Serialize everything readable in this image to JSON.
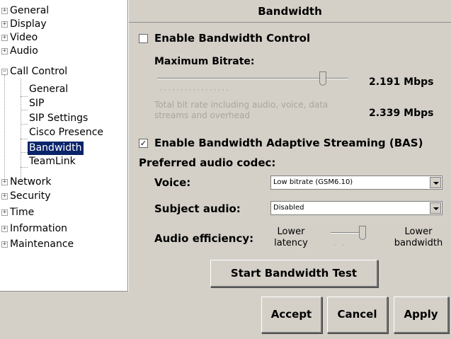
{
  "tree": {
    "items": [
      {
        "label": "General",
        "expander": "+"
      },
      {
        "label": "Display",
        "expander": "+"
      },
      {
        "label": "Video",
        "expander": "+"
      },
      {
        "label": "Audio",
        "expander": "+"
      },
      {
        "label": "Call Control",
        "expander": "−"
      },
      {
        "label": "General"
      },
      {
        "label": "SIP"
      },
      {
        "label": "SIP Settings"
      },
      {
        "label": "Cisco Presence"
      },
      {
        "label": "Bandwidth",
        "selected": true
      },
      {
        "label": "TeamLink"
      },
      {
        "label": "Network",
        "expander": "+"
      },
      {
        "label": "Security",
        "expander": "+"
      },
      {
        "label": "Time",
        "expander": "+"
      },
      {
        "label": "Information",
        "expander": "+"
      },
      {
        "label": "Maintenance",
        "expander": "+"
      }
    ]
  },
  "panel": {
    "title": "Bandwidth",
    "bandwidth_control": {
      "label": "Enable Bandwidth Control",
      "checked": false,
      "checkbox_glyph": "",
      "max_bitrate_label": "Maximum Bitrate:",
      "max_bitrate_value": "2.191 Mbps",
      "max_bitrate_level": 0.88,
      "total_note": "Total bit rate including audio, voice, data streams and overhead",
      "total_value": "2.339 Mbps"
    },
    "bas": {
      "label": "Enable Bandwidth Adaptive Streaming (BAS)",
      "checked": true,
      "checkbox_glyph": "✓"
    },
    "preferred_codec_label": "Preferred audio codec:",
    "voice": {
      "label": "Voice:",
      "value": "Low bitrate (GSM6.10)"
    },
    "subject_audio": {
      "label": "Subject audio:",
      "value": "Disabled"
    },
    "efficiency": {
      "label": "Audio efficiency:",
      "left": "Lower latency",
      "right": "Lower bandwidth",
      "level": 1.0
    },
    "test_button": "Start Bandwidth Test"
  },
  "footer": {
    "accept": "Accept",
    "cancel": "Cancel",
    "apply": "Apply"
  },
  "colors": {
    "panel_bg": "#d4d0c8",
    "selection": "#0a246a",
    "disabled_text": "#a9a59f"
  }
}
